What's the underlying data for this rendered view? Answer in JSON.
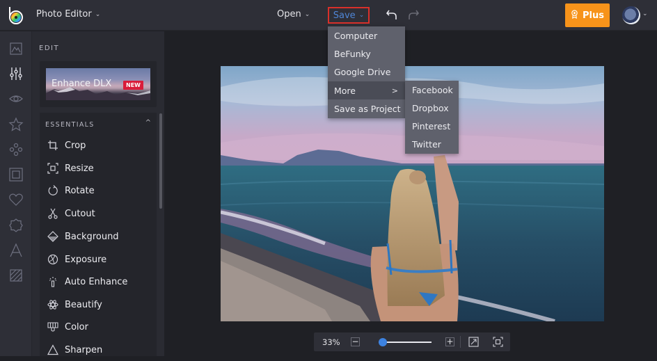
{
  "app": {
    "title": "Photo Editor",
    "brand_accent": "#f7931a",
    "save_highlight_color": "#d9302a"
  },
  "toolbar": {
    "open_label": "Open",
    "save_label": "Save",
    "undo_icon": "undo-icon",
    "redo_icon": "redo-icon",
    "plus_label": "Plus",
    "plus_icon": "award-icon",
    "chevron": "⌄"
  },
  "save_menu": {
    "items": [
      {
        "label": "Computer"
      },
      {
        "label": "BeFunky"
      },
      {
        "label": "Google Drive"
      },
      {
        "label": "More",
        "submenu_arrow": ">"
      },
      {
        "label": "Save as Project"
      }
    ]
  },
  "more_menu": {
    "items": [
      {
        "label": "Facebook"
      },
      {
        "label": "Dropbox"
      },
      {
        "label": "Pinterest"
      },
      {
        "label": "Twitter"
      }
    ]
  },
  "rail": {
    "icons": [
      "image-icon",
      "sliders-icon",
      "eye-icon",
      "star-icon",
      "graphics-icon",
      "frame-icon",
      "heart-icon",
      "badge-icon",
      "text-icon",
      "texture-icon"
    ],
    "active": "sliders-icon"
  },
  "panel": {
    "section_label": "EDIT",
    "enhance": {
      "title": "Enhance DLX",
      "badge": "NEW"
    },
    "essentials": {
      "header": "ESSENTIALS",
      "caret": "^",
      "tools": [
        {
          "label": "Crop",
          "icon": "crop-icon"
        },
        {
          "label": "Resize",
          "icon": "resize-icon"
        },
        {
          "label": "Rotate",
          "icon": "rotate-icon"
        },
        {
          "label": "Cutout",
          "icon": "scissors-icon"
        },
        {
          "label": "Background",
          "icon": "background-icon"
        },
        {
          "label": "Exposure",
          "icon": "exposure-icon"
        },
        {
          "label": "Auto Enhance",
          "icon": "magic-wand-icon"
        },
        {
          "label": "Beautify",
          "icon": "beautify-icon"
        },
        {
          "label": "Color",
          "icon": "color-icon"
        },
        {
          "label": "Sharpen",
          "icon": "sharpen-icon"
        }
      ]
    }
  },
  "zoom": {
    "percent_label": "33%",
    "slider_fraction": 0.08,
    "minus": "−",
    "plus": "+"
  }
}
